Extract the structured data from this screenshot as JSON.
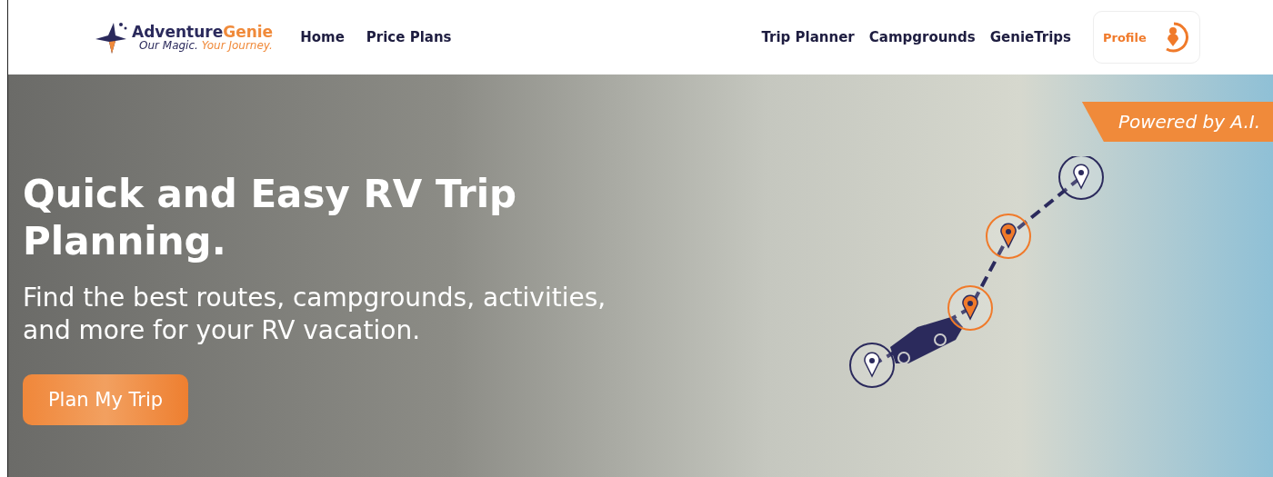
{
  "header": {
    "logo": {
      "name_dark": "Adventure",
      "name_accent": "Genie",
      "tagline_dark": "Our Magic.",
      "tagline_accent": "Your Journey."
    },
    "nav_left": [
      {
        "label": "Home"
      },
      {
        "label": "Price Plans"
      }
    ],
    "nav_right": [
      {
        "label": "Trip Planner"
      },
      {
        "label": "Campgrounds"
      },
      {
        "label": "GenieTrips"
      }
    ],
    "profile": {
      "label": "Profile"
    }
  },
  "hero": {
    "ribbon": "Powered by A.I.",
    "title": "Quick and Easy RV Trip Planning.",
    "subtitle": "Find the best routes, campgrounds, activities, and more for your RV vacation.",
    "cta": "Plan My Trip",
    "route_stops": [
      {
        "kind": "start"
      },
      {
        "kind": "waypoint"
      },
      {
        "kind": "waypoint"
      },
      {
        "kind": "end"
      }
    ]
  }
}
